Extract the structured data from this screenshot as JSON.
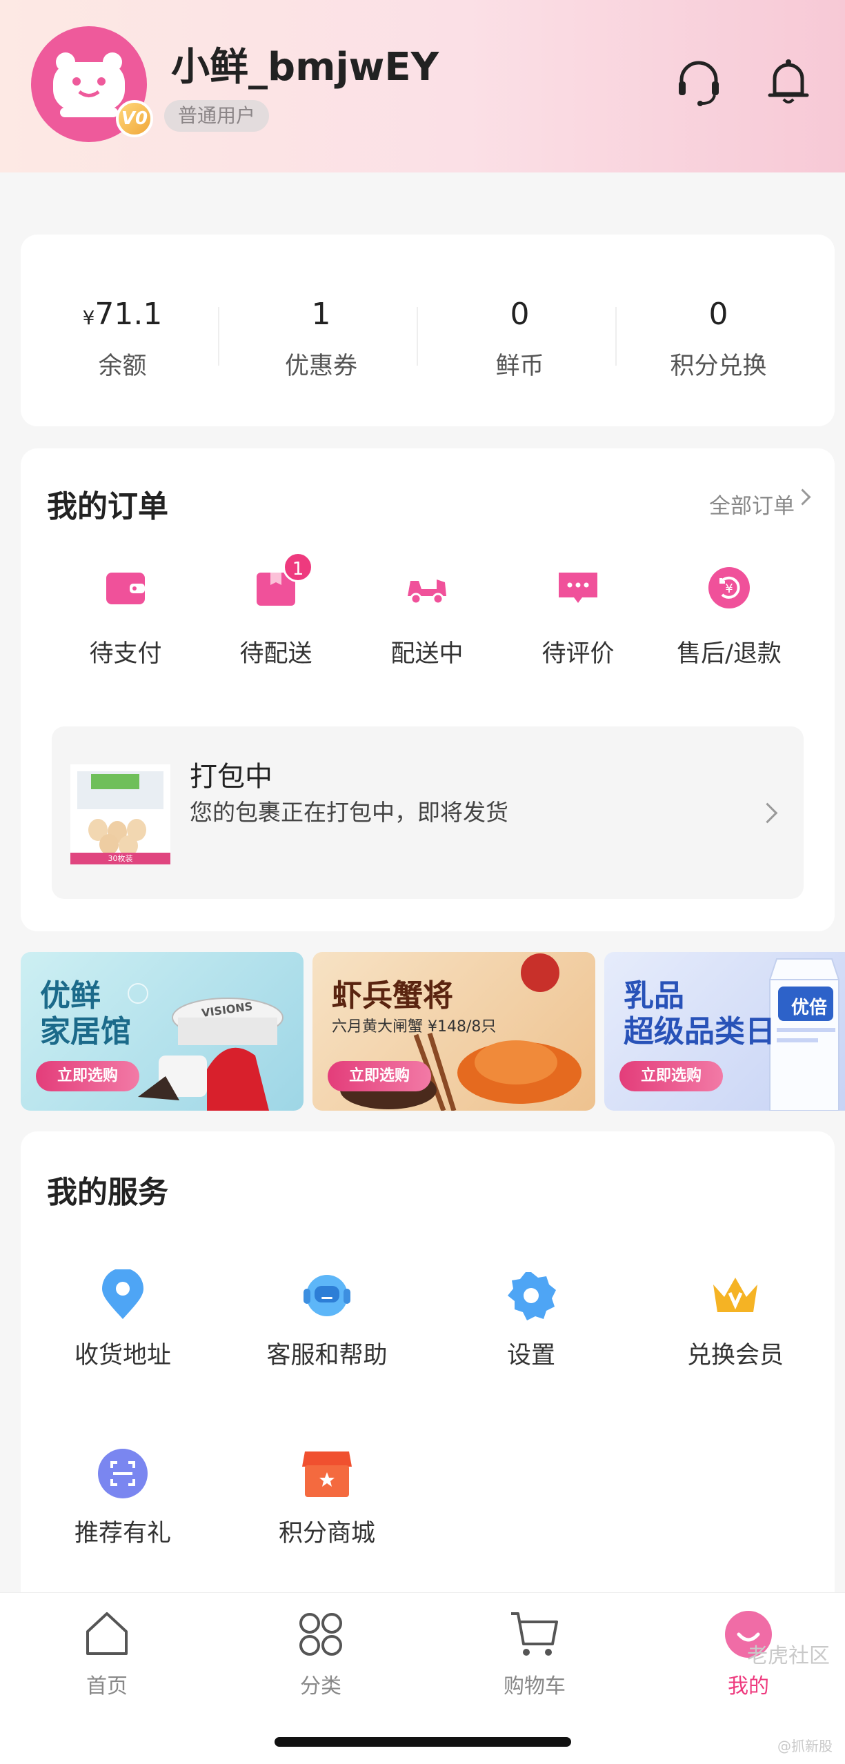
{
  "header": {
    "username": "小鲜_bmjwEY",
    "user_type": "普通用户",
    "level_badge": "V0",
    "icons": [
      "headset-icon",
      "bell-icon"
    ]
  },
  "stats": [
    {
      "currency": "¥",
      "value": "71.1",
      "label": "余额"
    },
    {
      "currency": "",
      "value": "1",
      "label": "优惠券"
    },
    {
      "currency": "",
      "value": "0",
      "label": "鲜币"
    },
    {
      "currency": "",
      "value": "0",
      "label": "积分兑换"
    }
  ],
  "orders": {
    "title": "我的订单",
    "all_link": "全部订单",
    "items": [
      {
        "label": "待支付",
        "icon": "wallet-icon",
        "badge": ""
      },
      {
        "label": "待配送",
        "icon": "package-icon",
        "badge": "1"
      },
      {
        "label": "配送中",
        "icon": "delivery-scooter-icon",
        "badge": ""
      },
      {
        "label": "待评价",
        "icon": "comment-icon",
        "badge": ""
      },
      {
        "label": "售后/退款",
        "icon": "refund-icon",
        "badge": ""
      }
    ],
    "packing": {
      "title": "打包中",
      "desc": "您的包裹正在打包中，即将发货",
      "thumb_tag": "30枚装"
    }
  },
  "banners": [
    {
      "title_line1": "优鲜",
      "title_line2": "家居馆",
      "subtitle": "",
      "button": "立即选购",
      "product_label": "VISIONS"
    },
    {
      "title_line1": "虾兵蟹将",
      "title_line2": "",
      "subtitle": "六月黄大闸蟹 ¥148/8只",
      "button": "立即选购",
      "product_label": ""
    },
    {
      "title_line1": "乳品",
      "title_line2": "超级品类日",
      "subtitle": "",
      "button": "立即选购",
      "product_label": "优倍"
    }
  ],
  "services": {
    "title": "我的服务",
    "items": [
      {
        "label": "收货地址",
        "icon": "location-pin-icon"
      },
      {
        "label": "客服和帮助",
        "icon": "customer-service-icon"
      },
      {
        "label": "设置",
        "icon": "settings-gear-icon"
      },
      {
        "label": "兑换会员",
        "icon": "crown-icon"
      },
      {
        "label": "推荐有礼",
        "icon": "scan-icon"
      },
      {
        "label": "积分商城",
        "icon": "store-icon"
      }
    ]
  },
  "tabbar": {
    "items": [
      {
        "label": "首页",
        "icon": "home-icon",
        "active": false
      },
      {
        "label": "分类",
        "icon": "category-icon",
        "active": false
      },
      {
        "label": "购物车",
        "icon": "cart-icon",
        "active": false
      },
      {
        "label": "我的",
        "icon": "profile-smile-icon",
        "active": true
      }
    ]
  },
  "watermark": {
    "main": "老虎社区",
    "sub": "@抓新股"
  },
  "colors": {
    "accent": "#ee3a7e",
    "pink_icon": "#f0519a",
    "blue_icon": "#4ea5f5",
    "gold_icon": "#f5b324",
    "red_icon": "#f0502f"
  }
}
